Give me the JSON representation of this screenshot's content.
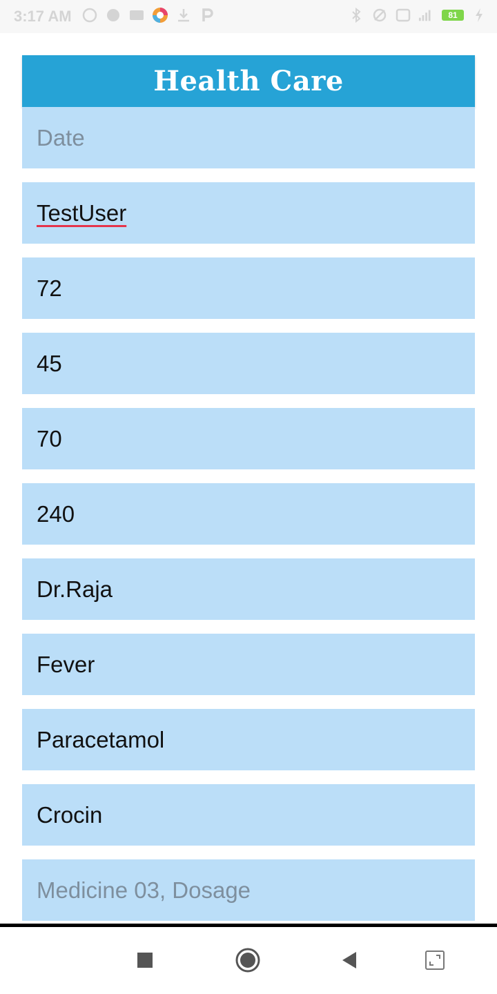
{
  "status_bar": {
    "time": "3:17 AM",
    "battery": "81"
  },
  "header": {
    "title": "Health Care"
  },
  "form": {
    "fields": [
      {
        "name": "date-field",
        "value": "",
        "placeholder": "Date"
      },
      {
        "name": "username-field",
        "value": "TestUser",
        "placeholder": ""
      },
      {
        "name": "field-3",
        "value": "72",
        "placeholder": ""
      },
      {
        "name": "field-4",
        "value": "45",
        "placeholder": ""
      },
      {
        "name": "field-5",
        "value": "70",
        "placeholder": ""
      },
      {
        "name": "field-6",
        "value": "240",
        "placeholder": ""
      },
      {
        "name": "doctor-field",
        "value": "Dr.Raja",
        "placeholder": ""
      },
      {
        "name": "disease-field",
        "value": "Fever",
        "placeholder": ""
      },
      {
        "name": "medicine-01-field",
        "value": "Paracetamol",
        "placeholder": ""
      },
      {
        "name": "medicine-02-field",
        "value": "Crocin",
        "placeholder": ""
      },
      {
        "name": "medicine-03-dosage-field",
        "value": "",
        "placeholder": "Medicine 03, Dosage"
      }
    ]
  },
  "nav": {
    "icons": [
      "recents-icon",
      "home-icon",
      "back-icon",
      "screenshot-icon"
    ]
  }
}
